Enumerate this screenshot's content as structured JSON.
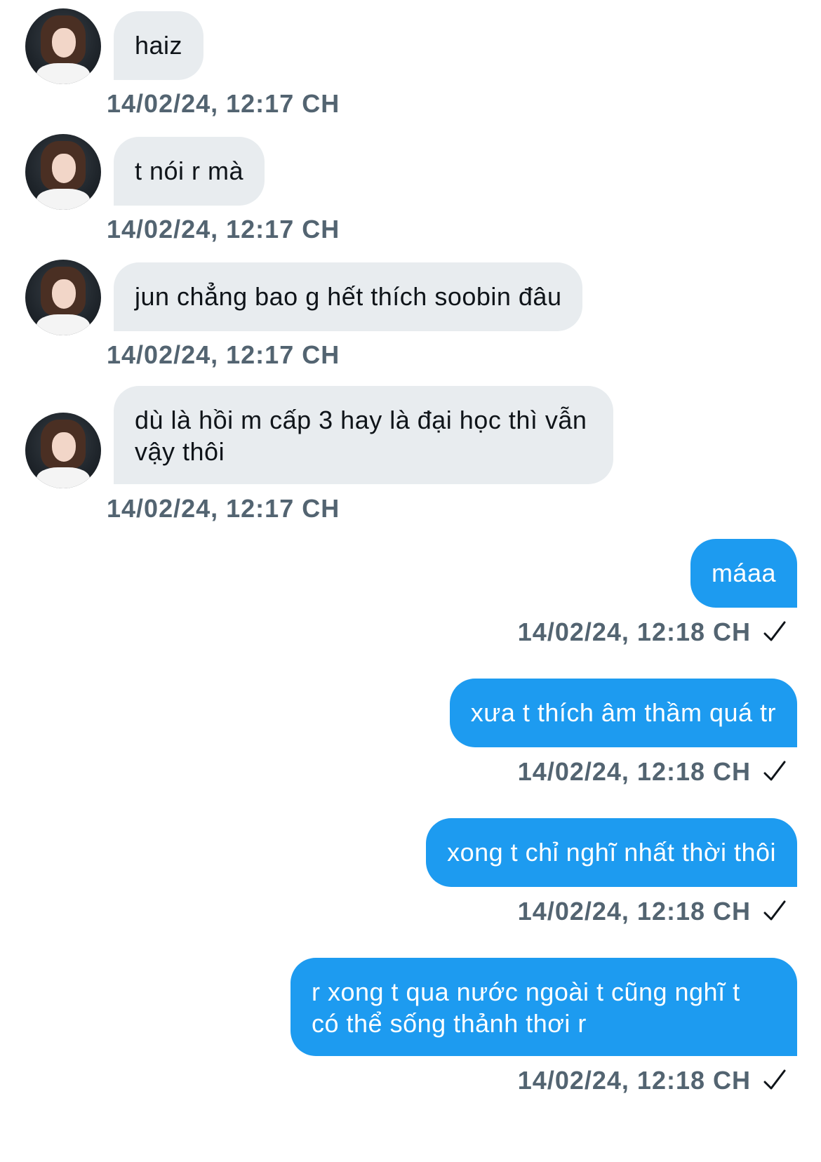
{
  "messages": [
    {
      "direction": "in",
      "text": "haiz",
      "timestamp": "14/02/24, 12:17 CH"
    },
    {
      "direction": "in",
      "text": "t nói r mà",
      "timestamp": "14/02/24, 12:17 CH"
    },
    {
      "direction": "in",
      "text": "jun chẳng bao g hết thích soobin đâu",
      "timestamp": "14/02/24, 12:17 CH"
    },
    {
      "direction": "in",
      "text": "dù là hồi m cấp 3 hay là đại học thì vẫn\nvậy thôi",
      "timestamp": "14/02/24, 12:17 CH"
    },
    {
      "direction": "out",
      "text": "máaa",
      "timestamp": "14/02/24, 12:18 CH"
    },
    {
      "direction": "out",
      "text": "xưa t thích âm thầm quá tr",
      "timestamp": "14/02/24, 12:18 CH"
    },
    {
      "direction": "out",
      "text": "xong t chỉ nghĩ nhất thời thôi",
      "timestamp": "14/02/24, 12:18 CH"
    },
    {
      "direction": "out",
      "text": "r xong t qua nước ngoài t cũng nghĩ t\ncó thể sống thảnh thơi r",
      "timestamp": "14/02/24, 12:18 CH"
    }
  ],
  "colors": {
    "incoming_bubble": "#e8ecef",
    "outgoing_bubble": "#1d9bf0",
    "timestamp": "#536471"
  },
  "icons": {
    "avatar": "profile-photo",
    "sent_status": "checkmark-icon"
  }
}
